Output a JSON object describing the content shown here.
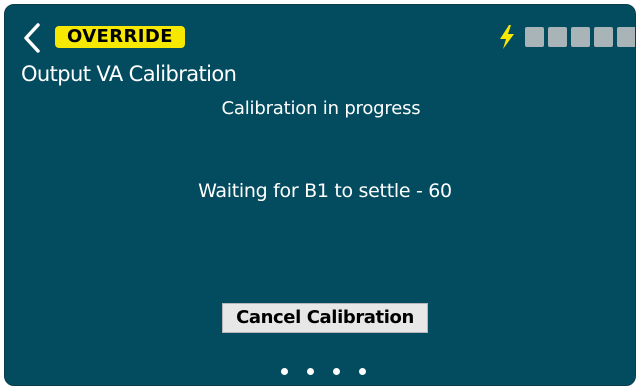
{
  "header": {
    "back_icon": "chevron-left-icon",
    "badge_label": "OVERRIDE",
    "bolt_icon": "lightning-bolt-icon",
    "battery_bar_count": 5
  },
  "screen": {
    "title": "Output VA Calibration",
    "status_heading": "Calibration in progress",
    "wait_message": "Waiting for B1 to settle - 60"
  },
  "actions": {
    "cancel_label": "Cancel Calibration"
  },
  "pagination": {
    "dot_count": 4
  },
  "colors": {
    "background": "#034c60",
    "badge": "#f6e800",
    "bolt": "#f6e800",
    "battery_bar": "#a9b4b9",
    "button": "#e7e7e7"
  }
}
